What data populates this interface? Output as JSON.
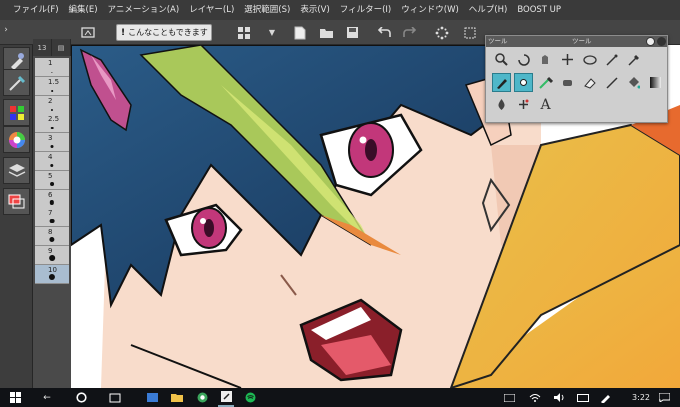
{
  "menubar": {
    "items": [
      "ファイル(F)",
      "編集(E)",
      "アニメーション(A)",
      "レイヤー(L)",
      "選択範囲(S)",
      "表示(V)",
      "フィルター(I)",
      "ウィンドウ(W)",
      "ヘルプ(H)",
      "BOOST UP"
    ]
  },
  "commandbar": {
    "tip_button_label": "こんなこともできます",
    "icons": [
      "dock-toggle-icon",
      "grid-layout-icon",
      "dropdown-icon",
      "new-file-icon",
      "open-folder-icon",
      "save-icon",
      "undo-icon",
      "redo-icon",
      "loading-icon",
      "transform-icon",
      "selection-icon"
    ]
  },
  "left_panel": {
    "buttons": [
      "tool-icon",
      "brush-icon",
      "color-set-icon",
      "color-wheel-icon",
      "layer-icon",
      "layers-stack-icon"
    ]
  },
  "size_column": {
    "tabs": [
      "13",
      "▤"
    ],
    "sizes": [
      "1",
      "1.5",
      "2",
      "2.5",
      "3",
      "4",
      "5",
      "6",
      "7",
      "8",
      "9",
      "10"
    ],
    "selected": "10"
  },
  "tool_palette": {
    "title_left": "ツール",
    "title_right": "ツール",
    "rows": [
      [
        "zoom-icon",
        "rotate-icon",
        "move-icon",
        "layer-move-icon",
        "lasso-icon",
        "wand-icon",
        "eyedropper-icon"
      ],
      [
        "pen-icon",
        "pencil-icon",
        "brush-icon",
        "airbrush-icon",
        "eraser-icon",
        "line-icon",
        "fill-icon",
        "gradient-icon"
      ],
      [
        "blend-icon",
        "correct-icon",
        "text-icon"
      ]
    ],
    "selected": [
      "pen-icon",
      "pencil-icon"
    ],
    "text_tool_glyph": "A"
  },
  "taskbar": {
    "time": "3:22",
    "items": [
      "windows-start-icon",
      "back-icon",
      "cortana-icon",
      "task-view-icon",
      "explorer-icon",
      "chrome-icon",
      "clip-studio-icon",
      "spotify-icon"
    ],
    "tray": [
      "tablet-mode-icon",
      "wifi-icon",
      "volume-icon",
      "keyboard-icon",
      "pen-icon",
      "notification-icon"
    ]
  },
  "colors": {
    "hair_dark": "#1f3f66",
    "hair_green": "#a9c85a",
    "eye_pink": "#c2377a",
    "skin": "#f6d6c3",
    "scarf": "#f2b83a",
    "tool_select": "#4fb7c9"
  }
}
